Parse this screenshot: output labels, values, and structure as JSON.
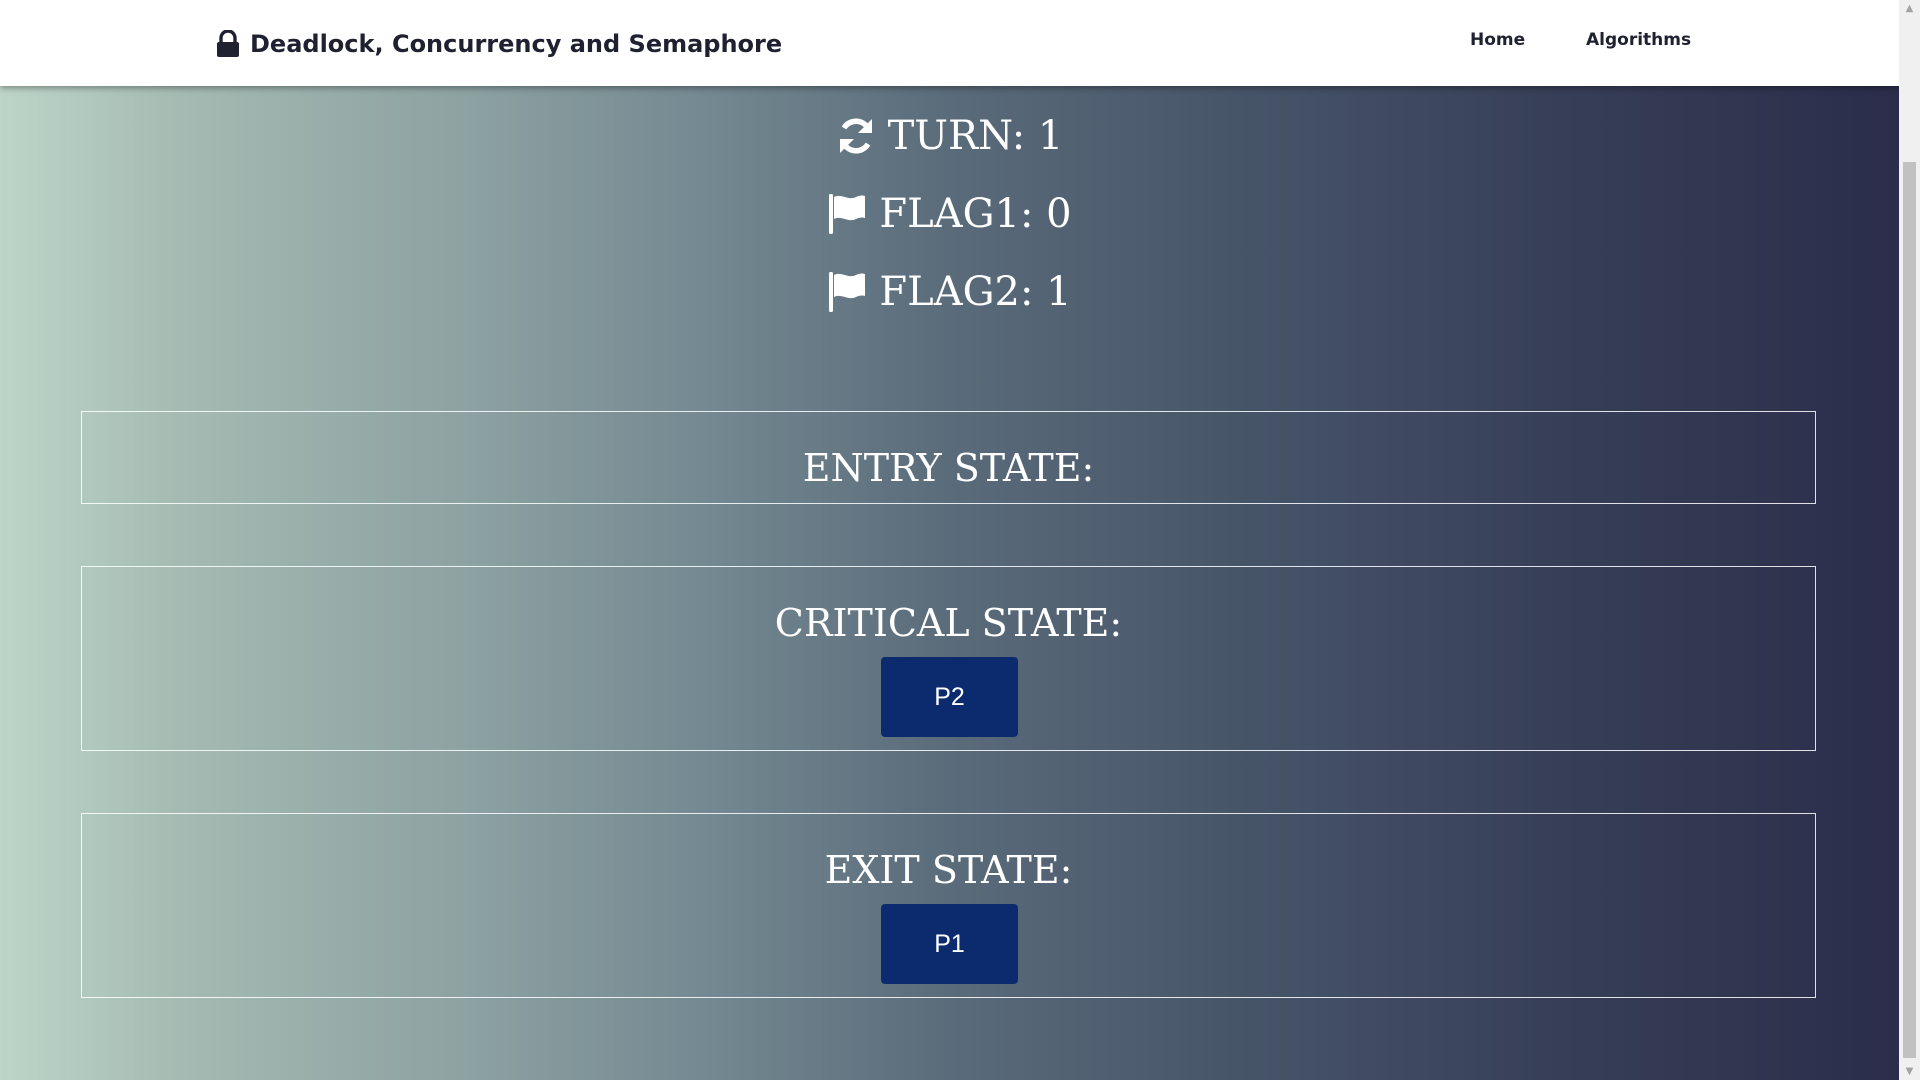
{
  "navbar": {
    "brand_title": "Deadlock, Concurrency and Semaphore",
    "brand_icon": "lock-icon",
    "links": [
      {
        "label": "Home"
      },
      {
        "label": "Algorithms"
      }
    ]
  },
  "status": {
    "turn": {
      "icon": "sync-icon",
      "text": "TURN: 1"
    },
    "flag1": {
      "icon": "flag-icon",
      "text": "FLAG1: 0"
    },
    "flag2": {
      "icon": "flag-icon",
      "text": "FLAG2: 1"
    }
  },
  "states": {
    "entry": {
      "title": "ENTRY STATE:"
    },
    "critical": {
      "title": "CRITICAL STATE:",
      "process": "P2"
    },
    "exit": {
      "title": "EXIT STATE:",
      "process": "P1"
    }
  },
  "colors": {
    "navbar_bg": "#ffffff",
    "process_button": "#0c2a6e",
    "gradient_left": "#bcd5c8",
    "gradient_right": "#2b2d4a",
    "text_light": "#ffffff"
  }
}
